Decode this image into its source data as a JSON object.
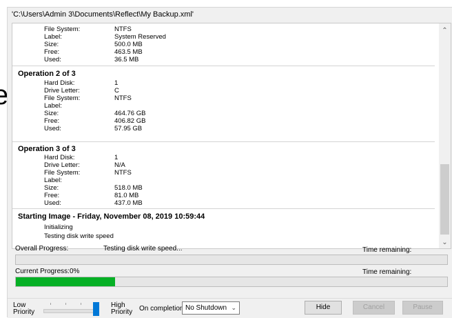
{
  "side_glyph": "e",
  "window": {
    "title": "'C:\\Users\\Admin 3\\Documents\\Reflect\\My Backup.xml'"
  },
  "log": {
    "op1_tail": [
      {
        "key": "File System:",
        "value": "NTFS"
      },
      {
        "key": "Label:",
        "value": "System Reserved"
      },
      {
        "key": "Size:",
        "value": "500.0 MB"
      },
      {
        "key": "Free:",
        "value": "463.5 MB"
      },
      {
        "key": "Used:",
        "value": "36.5 MB"
      }
    ],
    "op2": {
      "title": "Operation 2 of 3",
      "rows": [
        {
          "key": "Hard Disk:",
          "value": "1"
        },
        {
          "key": "Drive Letter:",
          "value": "C"
        },
        {
          "key": "File System:",
          "value": "NTFS"
        },
        {
          "key": "Label:",
          "value": ""
        },
        {
          "key": "Size:",
          "value": "464.76 GB"
        },
        {
          "key": "Free:",
          "value": "406.82 GB"
        },
        {
          "key": "Used:",
          "value": "57.95 GB"
        }
      ]
    },
    "op3": {
      "title": "Operation 3 of 3",
      "rows": [
        {
          "key": "Hard Disk:",
          "value": "1"
        },
        {
          "key": "Drive Letter:",
          "value": "N/A"
        },
        {
          "key": "File System:",
          "value": "NTFS"
        },
        {
          "key": "Label:",
          "value": ""
        },
        {
          "key": "Size:",
          "value": "518.0 MB"
        },
        {
          "key": "Free:",
          "value": "81.0 MB"
        },
        {
          "key": "Used:",
          "value": "437.0 MB"
        }
      ]
    },
    "imaging": {
      "title": "Starting Image - Friday, November 08, 2019 10:59:44",
      "lines": [
        "Initializing",
        "Testing disk write speed"
      ]
    }
  },
  "overall": {
    "label": "Overall Progress:",
    "status": "Testing disk write speed...",
    "time_label": "Time remaining:",
    "fraction": 0
  },
  "current": {
    "label": "Current Progress:",
    "percent_text": "0%",
    "time_label": "Time remaining:",
    "fraction": 0.23
  },
  "priority": {
    "low": [
      "Low",
      "Priority"
    ],
    "high": [
      "High",
      "Priority"
    ],
    "level": 1
  },
  "completion": {
    "label": "On completion",
    "selected": "No Shutdown"
  },
  "buttons": {
    "hide": "Hide",
    "cancel": "Cancel",
    "pause": "Pause"
  },
  "colors": {
    "progress_fill": "#06b025",
    "slider_thumb": "#0078d7"
  },
  "icons": {
    "scroll_up": "chevron-up-icon",
    "scroll_down": "chevron-down-icon",
    "dropdown": "chevron-down-icon"
  }
}
